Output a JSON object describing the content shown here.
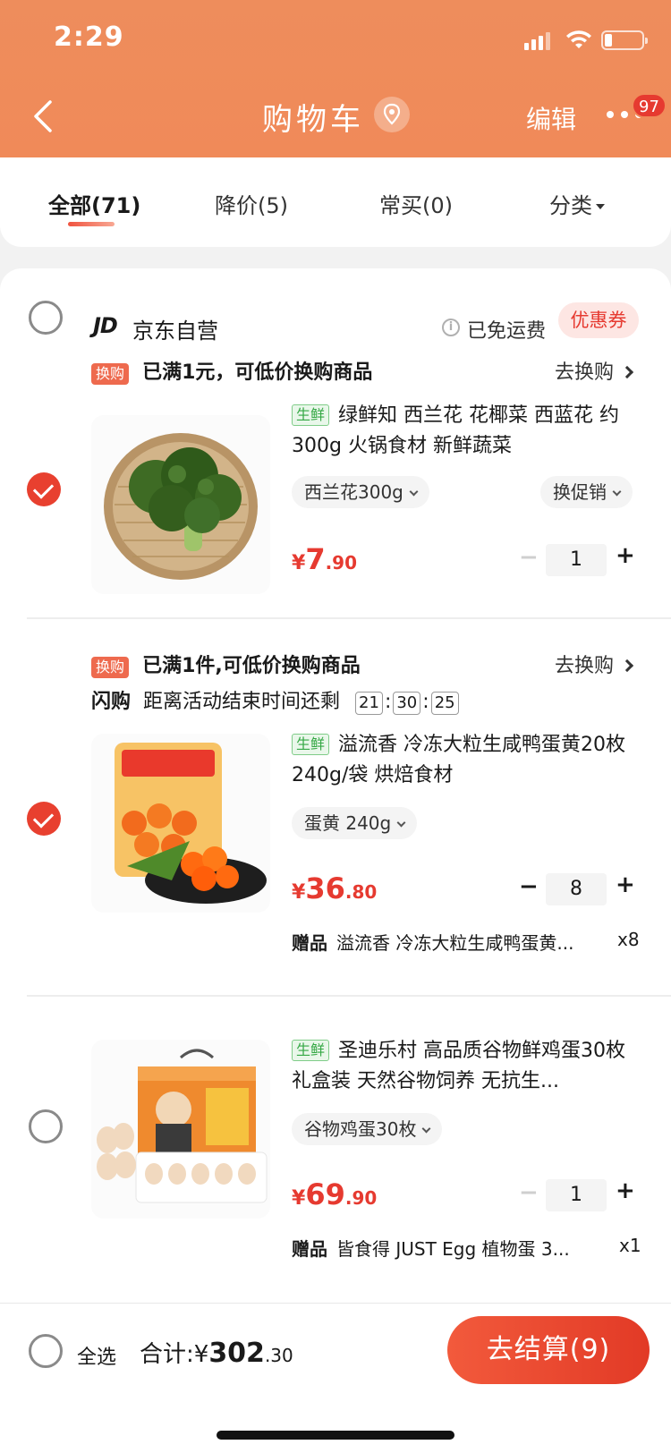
{
  "status": {
    "time": "2:29"
  },
  "nav": {
    "title": "购物车",
    "edit_label": "编辑",
    "badge": "97"
  },
  "tabs": [
    {
      "label": "全部(71)"
    },
    {
      "label": "降价(5)"
    },
    {
      "label": "常买(0)"
    },
    {
      "label": "分类"
    }
  ],
  "store": {
    "logo": "JD",
    "name": "京东自营",
    "shipping": "已免运费",
    "coupon": "优惠券"
  },
  "groups": [
    {
      "tag": "换购",
      "promo": "已满1元，可低价换购商品",
      "action": "去换购",
      "item": {
        "fresh_tag": "生鲜",
        "name": "绿鲜知 西兰花 花椰菜 西蓝花 约300g 火锅食材 新鲜蔬菜",
        "spec": "西兰花300g",
        "promo_select": "换促销",
        "price_symbol": "¥",
        "price_int": "7",
        "price_dec": ".90",
        "qty": "1",
        "checked": true
      }
    },
    {
      "tag": "换购",
      "promo": "已满1件,可低价换购商品",
      "action": "去换购",
      "flash_label": "闪购",
      "flash_text": "距离活动结束时间还剩",
      "timer": [
        "21",
        "30",
        "25"
      ],
      "item": {
        "fresh_tag": "生鲜",
        "name": "溢流香 冷冻大粒生咸鸭蛋黄20枚 240g/袋 烘焙食材",
        "spec": "蛋黄 240g",
        "price_symbol": "¥",
        "price_int": "36",
        "price_dec": ".80",
        "qty": "8",
        "gift_label": "赠品",
        "gift_text": "溢流香 冷冻大粒生咸鸭蛋黄...",
        "gift_count": "x8",
        "checked": true
      }
    },
    {
      "item": {
        "fresh_tag": "生鲜",
        "name": "圣迪乐村 高品质谷物鲜鸡蛋30枚礼盒装 天然谷物饲养 无抗生...",
        "spec": "谷物鸡蛋30枚",
        "price_symbol": "¥",
        "price_int": "69",
        "price_dec": ".90",
        "qty": "1",
        "gift_label": "赠品",
        "gift_text": "皆食得 JUST Egg 植物蛋 3...",
        "gift_count": "x1",
        "checked": false
      }
    }
  ],
  "footer": {
    "select_all": "全选",
    "total_label": "合计:",
    "total_symbol": "¥",
    "total_int": "302",
    "total_dec": ".30",
    "checkout": "去结算(9)"
  },
  "colors": {
    "header": "#f08a59",
    "accent": "#e63a30",
    "fresh": "#35a845"
  }
}
